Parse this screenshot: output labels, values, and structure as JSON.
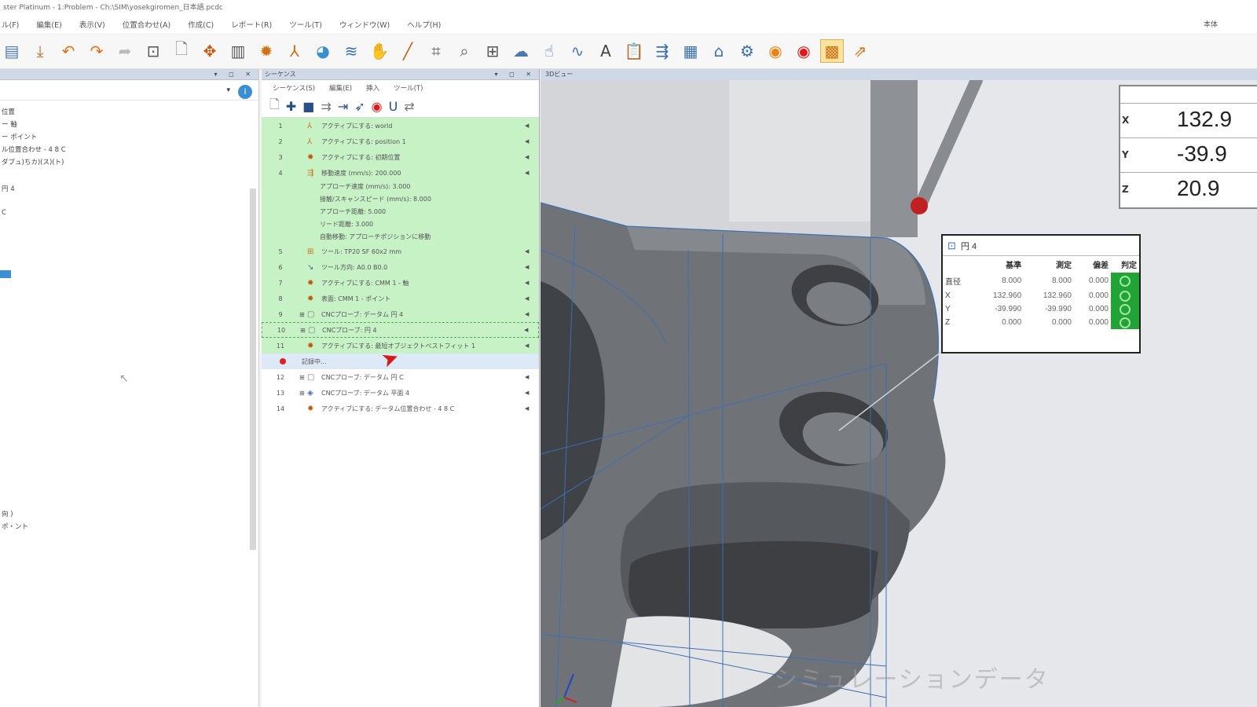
{
  "window": {
    "title": "ster Platinum - 1:Problem - Ch:\\SIM\\yosekgiromen_日本語.pcdc"
  },
  "menubar": {
    "items": [
      "ル(F)",
      "編集(E)",
      "表示(V)",
      "位置合わせ(A)",
      "作成(C)",
      "レポート(R)",
      "ツール(T)",
      "ウィンドウ(W)",
      "ヘルプ(H)"
    ],
    "right_text": "本体"
  },
  "left_panel": {
    "header": "",
    "tree": [
      "位置",
      "ー 軸",
      "ー ポイント",
      "ル位置合わせ - 4 8 C",
      "ダブュ)ちカ)(ス)(ト)",
      "円 4",
      "C",
      "",
      "向 )",
      "ポ・ント"
    ]
  },
  "sequence": {
    "header": "シーケンス",
    "menu": [
      "シーケンス(S)",
      "編集(E)",
      "挿入",
      "ツール(T)"
    ],
    "rows": [
      {
        "num": "1",
        "text": "アクティブにする: world",
        "style": "green"
      },
      {
        "num": "2",
        "text": "アクティブにする: position 1",
        "style": "green"
      },
      {
        "num": "3",
        "text": "アクティブにする: 初期位置",
        "style": "green"
      },
      {
        "num": "4",
        "text": "移動速度 (mm/s): 200.000",
        "style": "green"
      },
      {
        "num": "5",
        "text": "ツール: TP20 SF 60x2 mm",
        "style": "green"
      },
      {
        "num": "6",
        "text": "ツール方向: A0.0 B0.0",
        "style": "green"
      },
      {
        "num": "7",
        "text": "アクティブにする: CMM 1 - 軸",
        "style": "green"
      },
      {
        "num": "8",
        "text": "表面: CMM 1 - ポイント",
        "style": "green"
      },
      {
        "num": "9",
        "text": "CNCプローブ: データム 円 4",
        "style": "green"
      },
      {
        "num": "10",
        "text": "CNCプローブ: 円 4",
        "style": "green-sel"
      },
      {
        "num": "11",
        "text": "アクティブにする: 最短オブジェクトベストフィット 1",
        "style": "green"
      },
      {
        "num": "",
        "text": "記録中...",
        "style": "bluesel"
      },
      {
        "num": "12",
        "text": "CNCプローブ: データム 円 C",
        "style": "plain"
      },
      {
        "num": "13",
        "text": "CNCプローブ: データム 平面 4",
        "style": "plain"
      },
      {
        "num": "14",
        "text": "アクティブにする: データム位置合わせ - 4 8 C",
        "style": "plain"
      }
    ],
    "sub_params": [
      "アプローチ速度 (mm/s): 3.000",
      "接触/スキャンスピード (mm/s): 8.000",
      "アプローチ距離: 5.000",
      "リード距離: 3.000",
      "自動移動: アプローチポジションに移動"
    ]
  },
  "viewport": {
    "header": "3Dビュー",
    "watermark": "シミュレーションデータ"
  },
  "coords": {
    "rows": [
      {
        "axis": "X",
        "value": "132.9"
      },
      {
        "axis": "Y",
        "value": "-39.9"
      },
      {
        "axis": "Z",
        "value": "20.9"
      }
    ]
  },
  "measurement": {
    "title": "円 4",
    "headers": [
      "",
      "基準",
      "測定",
      "偏差",
      "判定"
    ],
    "rows": [
      {
        "label": "直径",
        "nominal": "8.000",
        "measured": "8.000",
        "dev": "0.000"
      },
      {
        "label": "X",
        "nominal": "132.960",
        "measured": "132.960",
        "dev": "0.000"
      },
      {
        "label": "Y",
        "nominal": "-39.990",
        "measured": "-39.990",
        "dev": "0.000"
      },
      {
        "label": "Z",
        "nominal": "0.000",
        "measured": "0.000",
        "dev": "0.000"
      }
    ]
  },
  "colors": {
    "seq_green": "#c6f2c6",
    "ok_green": "#21a336",
    "panel_header": "#cfd9e6",
    "part_gray": "#6f7378",
    "part_edge": "#3d6fb4"
  }
}
